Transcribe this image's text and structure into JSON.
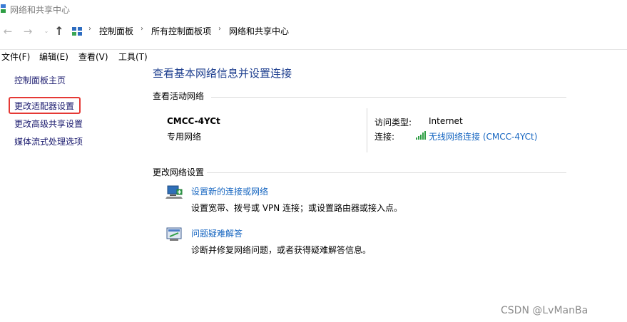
{
  "window": {
    "title": "网络和共享中心"
  },
  "navigation": {
    "back_icon": "←",
    "forward_icon": "→",
    "recent_icon": "⌄",
    "up_icon": "↑",
    "breadcrumb": [
      "控制面板",
      "所有控制面板项",
      "网络和共享中心"
    ],
    "separator": "›"
  },
  "menubar": {
    "items": [
      "文件(F)",
      "编辑(E)",
      "查看(V)",
      "工具(T)"
    ]
  },
  "sidebar": {
    "items": [
      "控制面板主页",
      "更改适配器设置",
      "更改高级共享设置",
      "媒体流式处理选项"
    ],
    "highlight_color": "#e53935"
  },
  "main": {
    "title": "查看基本网络信息并设置连接",
    "active_section": "查看活动网络",
    "network": {
      "name": "CMCC-4YCt",
      "type": "专用网络",
      "access_label": "访问类型:",
      "access_value": "Internet",
      "connection_label": "连接:",
      "connection_value": "无线网络连接 (CMCC-4YCt)"
    },
    "change_section": "更改网络设置",
    "tasks": [
      {
        "link": "设置新的连接或网络",
        "desc": "设置宽带、拨号或 VPN 连接；或设置路由器或接入点。",
        "icon": "new-connection-icon"
      },
      {
        "link": "问题疑难解答",
        "desc": "诊断并修复网络问题，或者获得疑难解答信息。",
        "icon": "troubleshoot-icon"
      }
    ]
  },
  "colors": {
    "link": "#1565c0",
    "title": "#1e3f8f",
    "sidebar_link": "#1a1a6e"
  },
  "watermark": "CSDN @LvManBa"
}
